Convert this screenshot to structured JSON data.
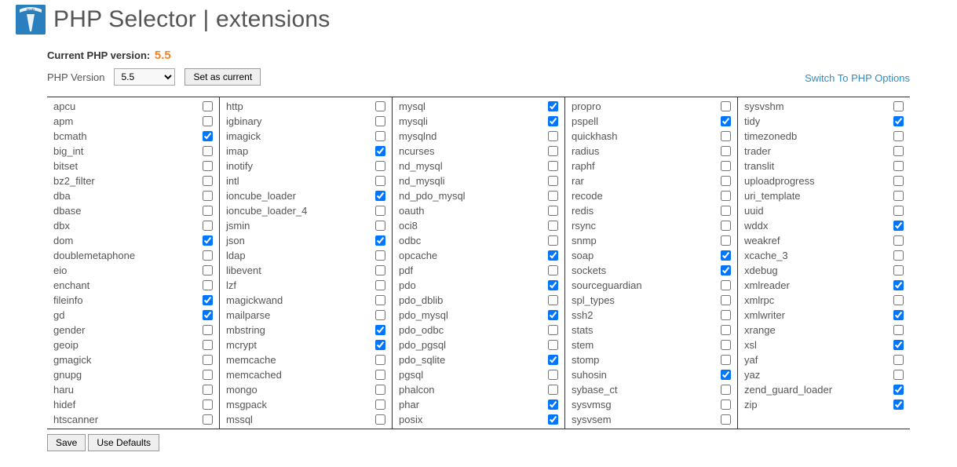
{
  "header": {
    "title": "PHP Selector | extensions"
  },
  "top": {
    "current_version_label": "Current PHP version:",
    "current_version_value": "5.5",
    "php_version_label": "PHP Version",
    "selected_version": "5.5",
    "set_as_current_btn": "Set as current",
    "switch_link": "Switch To PHP Options"
  },
  "buttons": {
    "save": "Save",
    "use_defaults": "Use Defaults"
  },
  "columns": [
    [
      {
        "name": "apcu",
        "checked": false
      },
      {
        "name": "apm",
        "checked": false
      },
      {
        "name": "bcmath",
        "checked": true
      },
      {
        "name": "big_int",
        "checked": false
      },
      {
        "name": "bitset",
        "checked": false
      },
      {
        "name": "bz2_filter",
        "checked": false
      },
      {
        "name": "dba",
        "checked": false
      },
      {
        "name": "dbase",
        "checked": false
      },
      {
        "name": "dbx",
        "checked": false
      },
      {
        "name": "dom",
        "checked": true
      },
      {
        "name": "doublemetaphone",
        "checked": false
      },
      {
        "name": "eio",
        "checked": false
      },
      {
        "name": "enchant",
        "checked": false
      },
      {
        "name": "fileinfo",
        "checked": true
      },
      {
        "name": "gd",
        "checked": true
      },
      {
        "name": "gender",
        "checked": false
      },
      {
        "name": "geoip",
        "checked": false
      },
      {
        "name": "gmagick",
        "checked": false
      },
      {
        "name": "gnupg",
        "checked": false
      },
      {
        "name": "haru",
        "checked": false
      },
      {
        "name": "hidef",
        "checked": false
      },
      {
        "name": "htscanner",
        "checked": false
      }
    ],
    [
      {
        "name": "http",
        "checked": false
      },
      {
        "name": "igbinary",
        "checked": false
      },
      {
        "name": "imagick",
        "checked": false
      },
      {
        "name": "imap",
        "checked": true
      },
      {
        "name": "inotify",
        "checked": false
      },
      {
        "name": "intl",
        "checked": false
      },
      {
        "name": "ioncube_loader",
        "checked": true
      },
      {
        "name": "ioncube_loader_4",
        "checked": false
      },
      {
        "name": "jsmin",
        "checked": false
      },
      {
        "name": "json",
        "checked": true
      },
      {
        "name": "ldap",
        "checked": false
      },
      {
        "name": "libevent",
        "checked": false
      },
      {
        "name": "lzf",
        "checked": false
      },
      {
        "name": "magickwand",
        "checked": false
      },
      {
        "name": "mailparse",
        "checked": false
      },
      {
        "name": "mbstring",
        "checked": true
      },
      {
        "name": "mcrypt",
        "checked": true
      },
      {
        "name": "memcache",
        "checked": false
      },
      {
        "name": "memcached",
        "checked": false
      },
      {
        "name": "mongo",
        "checked": false
      },
      {
        "name": "msgpack",
        "checked": false
      },
      {
        "name": "mssql",
        "checked": false
      }
    ],
    [
      {
        "name": "mysql",
        "checked": true
      },
      {
        "name": "mysqli",
        "checked": true
      },
      {
        "name": "mysqlnd",
        "checked": false
      },
      {
        "name": "ncurses",
        "checked": false
      },
      {
        "name": "nd_mysql",
        "checked": false
      },
      {
        "name": "nd_mysqli",
        "checked": false
      },
      {
        "name": "nd_pdo_mysql",
        "checked": false
      },
      {
        "name": "oauth",
        "checked": false
      },
      {
        "name": "oci8",
        "checked": false
      },
      {
        "name": "odbc",
        "checked": false
      },
      {
        "name": "opcache",
        "checked": true
      },
      {
        "name": "pdf",
        "checked": false
      },
      {
        "name": "pdo",
        "checked": true
      },
      {
        "name": "pdo_dblib",
        "checked": false
      },
      {
        "name": "pdo_mysql",
        "checked": true
      },
      {
        "name": "pdo_odbc",
        "checked": false
      },
      {
        "name": "pdo_pgsql",
        "checked": false
      },
      {
        "name": "pdo_sqlite",
        "checked": true
      },
      {
        "name": "pgsql",
        "checked": false
      },
      {
        "name": "phalcon",
        "checked": false
      },
      {
        "name": "phar",
        "checked": true
      },
      {
        "name": "posix",
        "checked": true
      }
    ],
    [
      {
        "name": "propro",
        "checked": false
      },
      {
        "name": "pspell",
        "checked": true
      },
      {
        "name": "quickhash",
        "checked": false
      },
      {
        "name": "radius",
        "checked": false
      },
      {
        "name": "raphf",
        "checked": false
      },
      {
        "name": "rar",
        "checked": false
      },
      {
        "name": "recode",
        "checked": false
      },
      {
        "name": "redis",
        "checked": false
      },
      {
        "name": "rsync",
        "checked": false
      },
      {
        "name": "snmp",
        "checked": false
      },
      {
        "name": "soap",
        "checked": true
      },
      {
        "name": "sockets",
        "checked": true
      },
      {
        "name": "sourceguardian",
        "checked": false
      },
      {
        "name": "spl_types",
        "checked": false
      },
      {
        "name": "ssh2",
        "checked": false
      },
      {
        "name": "stats",
        "checked": false
      },
      {
        "name": "stem",
        "checked": false
      },
      {
        "name": "stomp",
        "checked": false
      },
      {
        "name": "suhosin",
        "checked": true
      },
      {
        "name": "sybase_ct",
        "checked": false
      },
      {
        "name": "sysvmsg",
        "checked": false
      },
      {
        "name": "sysvsem",
        "checked": false
      }
    ],
    [
      {
        "name": "sysvshm",
        "checked": false
      },
      {
        "name": "tidy",
        "checked": true
      },
      {
        "name": "timezonedb",
        "checked": false
      },
      {
        "name": "trader",
        "checked": false
      },
      {
        "name": "translit",
        "checked": false
      },
      {
        "name": "uploadprogress",
        "checked": false
      },
      {
        "name": "uri_template",
        "checked": false
      },
      {
        "name": "uuid",
        "checked": false
      },
      {
        "name": "wddx",
        "checked": true
      },
      {
        "name": "weakref",
        "checked": false
      },
      {
        "name": "xcache_3",
        "checked": false
      },
      {
        "name": "xdebug",
        "checked": false
      },
      {
        "name": "xmlreader",
        "checked": true
      },
      {
        "name": "xmlrpc",
        "checked": false
      },
      {
        "name": "xmlwriter",
        "checked": true
      },
      {
        "name": "xrange",
        "checked": false
      },
      {
        "name": "xsl",
        "checked": true
      },
      {
        "name": "yaf",
        "checked": false
      },
      {
        "name": "yaz",
        "checked": false
      },
      {
        "name": "zend_guard_loader",
        "checked": true
      },
      {
        "name": "zip",
        "checked": true
      }
    ]
  ]
}
